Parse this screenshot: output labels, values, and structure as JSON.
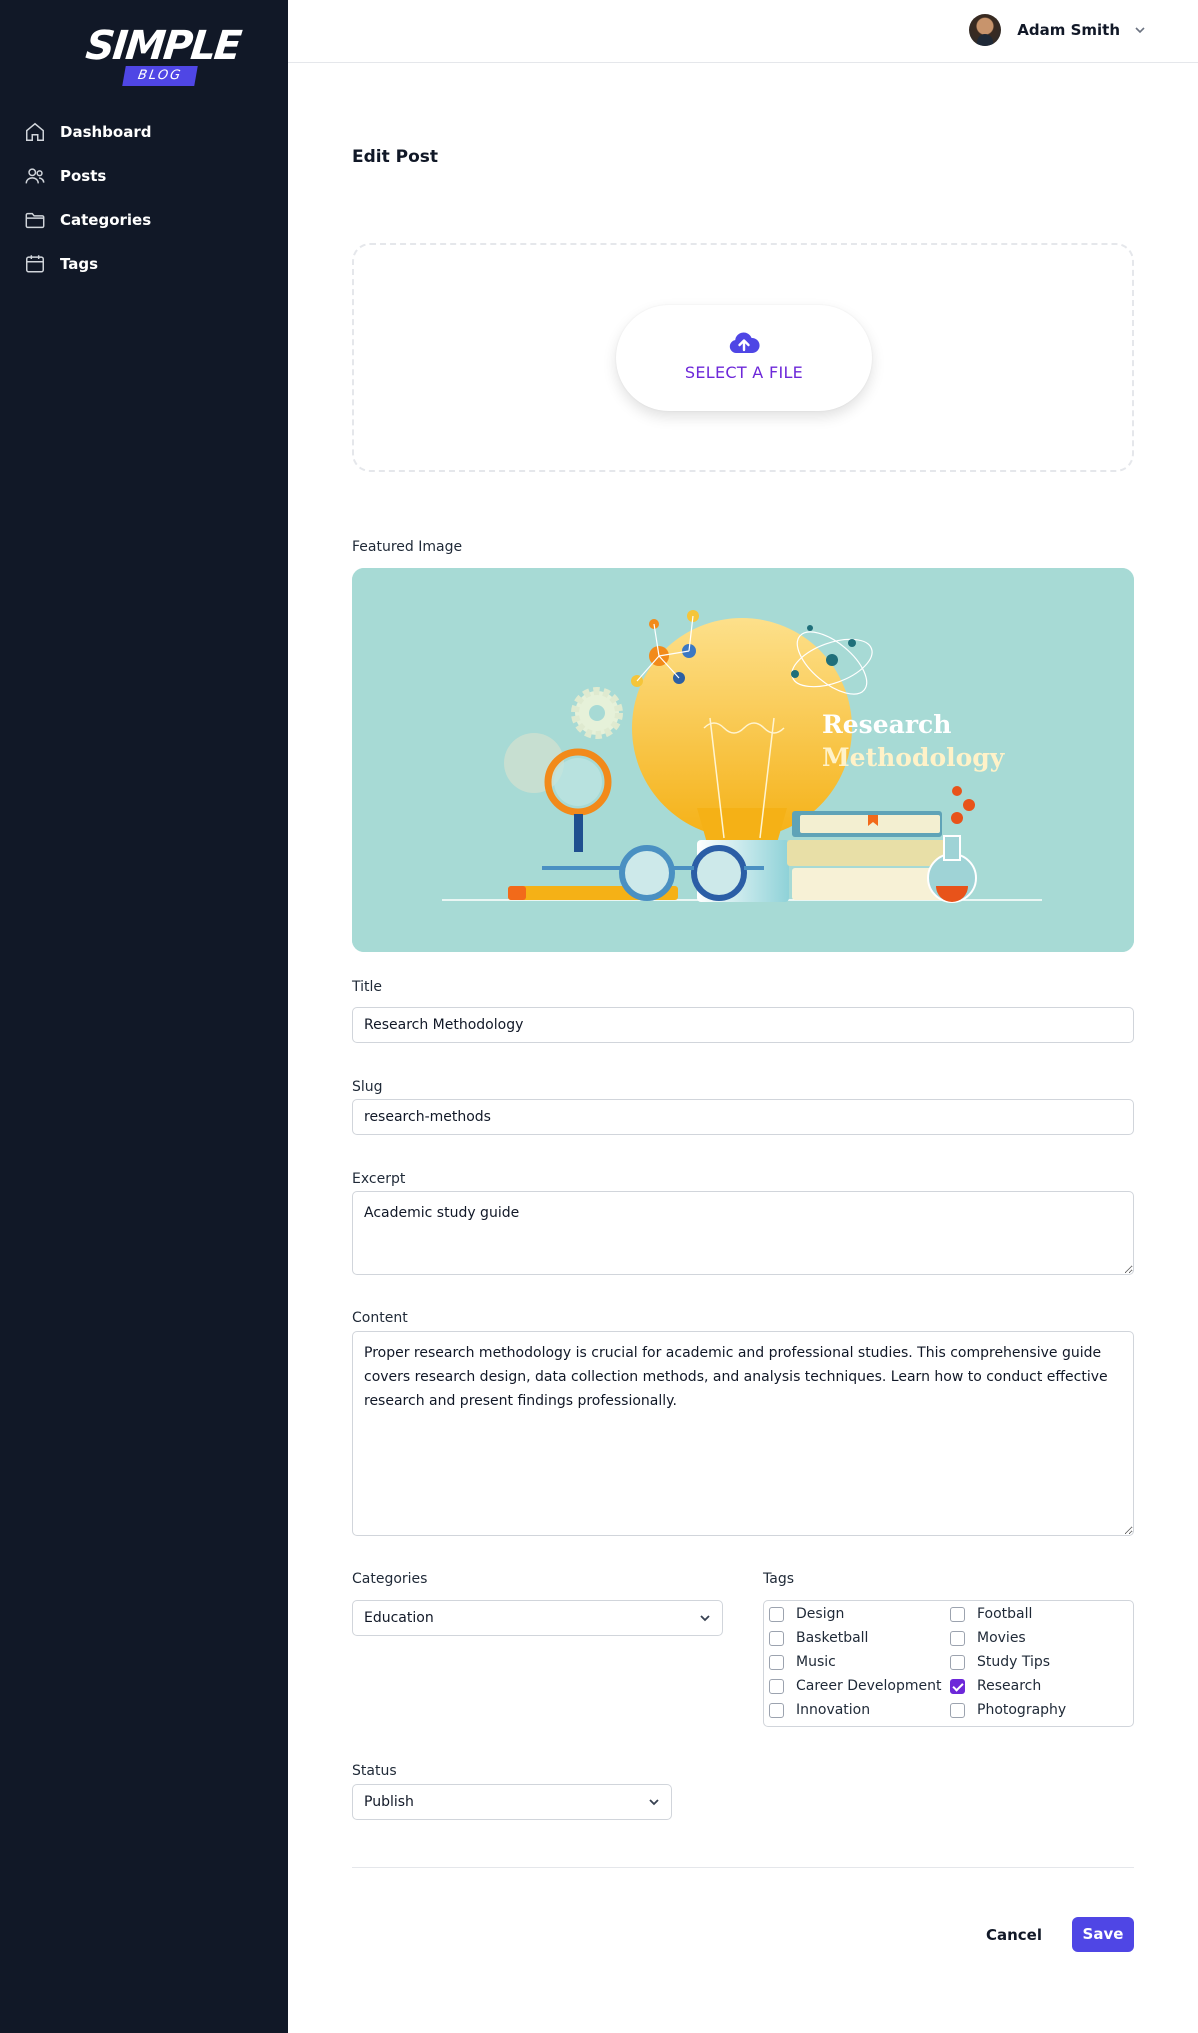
{
  "brand": {
    "name": "SIMPLE",
    "sub": "BLOG"
  },
  "sidebar": {
    "items": [
      {
        "label": "Dashboard",
        "icon": "home-icon"
      },
      {
        "label": "Posts",
        "icon": "users-icon"
      },
      {
        "label": "Categories",
        "icon": "folder-icon"
      },
      {
        "label": "Tags",
        "icon": "calendar-icon"
      }
    ]
  },
  "header": {
    "user_name": "Adam Smith"
  },
  "page": {
    "title": "Edit Post"
  },
  "upload": {
    "button_label": "SELECT A FILE",
    "icon": "cloud-upload-icon"
  },
  "featured": {
    "label": "Featured Image",
    "image_title_line1": "Research",
    "image_title_line2": "Methodology"
  },
  "form": {
    "title_label": "Title",
    "title_value": "Research Methodology",
    "slug_label": "Slug",
    "slug_value": "research-methods",
    "excerpt_label": "Excerpt",
    "excerpt_value": "Academic study guide",
    "content_label": "Content",
    "content_value": "Proper research methodology is crucial for academic and professional studies. This comprehensive guide covers research design, data collection methods, and analysis techniques. Learn how to conduct effective research and present findings professionally.",
    "categories_label": "Categories",
    "categories_value": "Education",
    "tags_label": "Tags",
    "tags": [
      {
        "label": "Design",
        "checked": false
      },
      {
        "label": "Football",
        "checked": false
      },
      {
        "label": "Basketball",
        "checked": false
      },
      {
        "label": "Movies",
        "checked": false
      },
      {
        "label": "Music",
        "checked": false
      },
      {
        "label": "Study Tips",
        "checked": false
      },
      {
        "label": "Career Development",
        "checked": false
      },
      {
        "label": "Research",
        "checked": true
      },
      {
        "label": "Innovation",
        "checked": false
      },
      {
        "label": "Photography",
        "checked": false
      }
    ],
    "status_label": "Status",
    "status_value": "Publish"
  },
  "actions": {
    "cancel_label": "Cancel",
    "save_label": "Save"
  },
  "colors": {
    "sidebar_bg": "#111827",
    "accent": "#4f46e5",
    "upload_text": "#6d28d9",
    "image_bg": "#a7dad5"
  }
}
